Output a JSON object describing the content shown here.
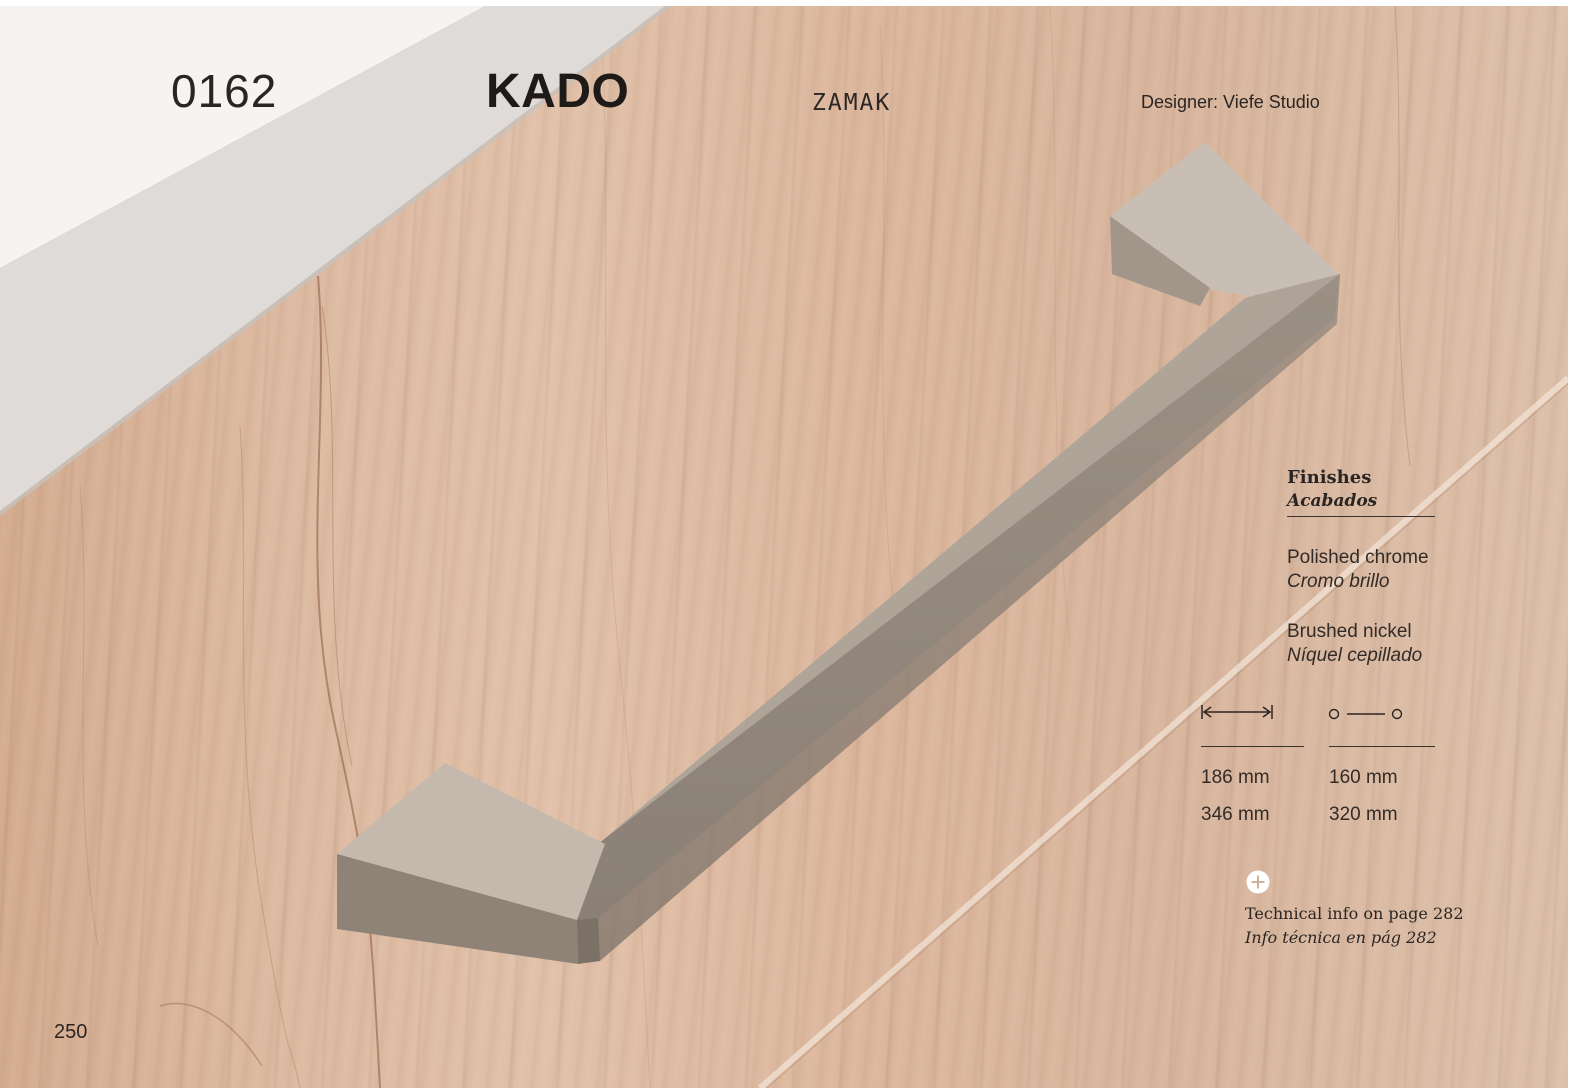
{
  "header": {
    "sku": "0162",
    "product_name": "KADO",
    "material": "ZAMAK",
    "designer": "Designer: Viefe Studio"
  },
  "finishes": {
    "title": "Finishes",
    "title_es": "Acabados",
    "items": [
      {
        "en": "Polished chrome",
        "es": "Cromo brillo"
      },
      {
        "en": "Brushed nickel",
        "es": "Níquel cepillado"
      }
    ]
  },
  "dimensions": {
    "length_icon": "overall-length-icon",
    "spacing_icon": "hole-spacing-icon",
    "length": [
      "186 mm",
      "346 mm"
    ],
    "spacing": [
      "160 mm",
      "320 mm"
    ]
  },
  "technical": {
    "icon": "plus-circle-icon",
    "en": "Technical info on page 282",
    "es": "Info técnica en pág 282"
  },
  "page_number": "250",
  "colors": {
    "wood": "#dcb9a0",
    "countertop": "#f2f0ee",
    "handle": "#b9ada2",
    "text": "#2a2522"
  }
}
